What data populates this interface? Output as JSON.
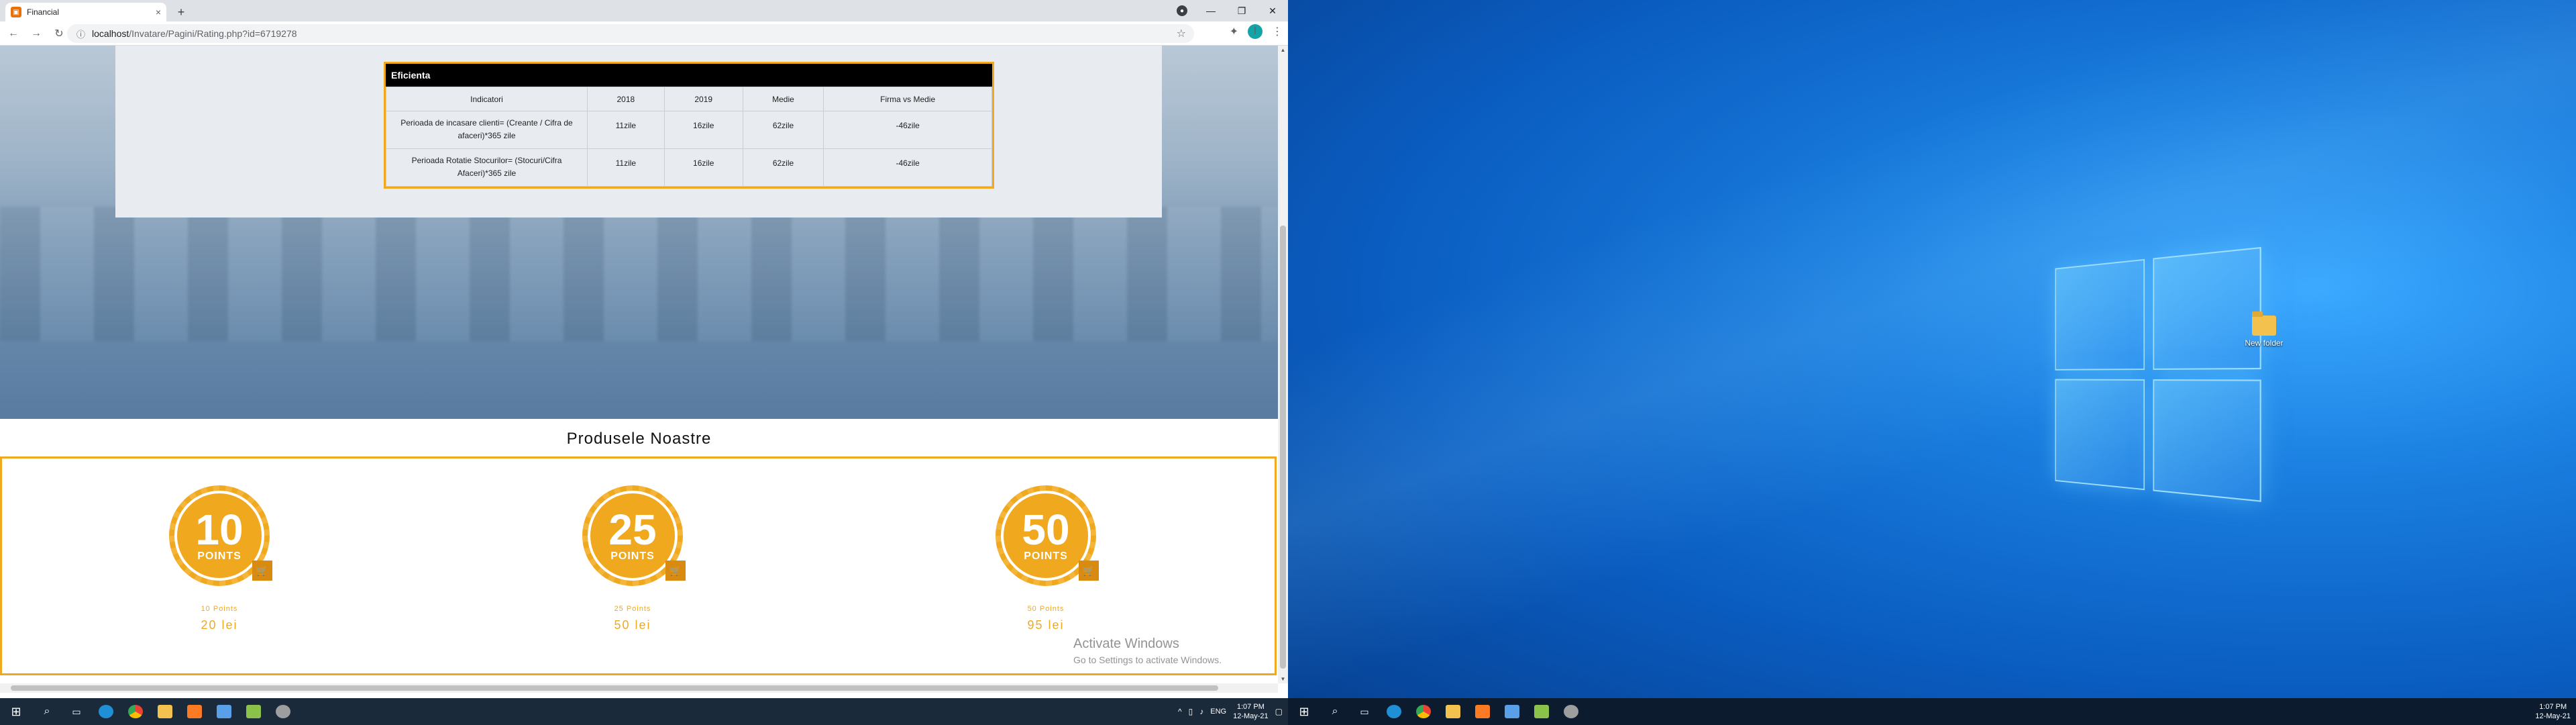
{
  "browser": {
    "tab_title": "Financial",
    "tab_close": "×",
    "newtab": "+",
    "url_host": "localhost",
    "url_path": "/Invatare/Pagini/Rating.php?id=6719278",
    "profile_initial": "I",
    "window_controls": [
      "—",
      "❐",
      "✕"
    ]
  },
  "efficiency_table": {
    "title": "Eficienta",
    "headers": [
      "Indicatori",
      "2018",
      "2019",
      "Medie",
      "Firma vs Medie"
    ],
    "rows": [
      {
        "indicator": "Perioada de incasare clienti= (Creante / Cifra de afaceri)*365 zile",
        "y2018": "11zile",
        "y2019": "16zile",
        "medie": "62zile",
        "vs": "-46zile"
      },
      {
        "indicator": "Perioada Rotatie Stocurilor= (Stocuri/Cifra Afaceri)*365 zile",
        "y2018": "11zile",
        "y2019": "16zile",
        "medie": "62zile",
        "vs": "-46zile"
      }
    ]
  },
  "products": {
    "title": "Produsele Noastre",
    "badge_label": "POINTS",
    "items": [
      {
        "number": "10",
        "points_text": "10 Points",
        "price": "20 lei"
      },
      {
        "number": "25",
        "points_text": "25 Points",
        "price": "50 lei"
      },
      {
        "number": "50",
        "points_text": "50 Points",
        "price": "95 lei"
      }
    ]
  },
  "watermark": {
    "line1": "Activate Windows",
    "line2": "Go to Settings to activate Windows."
  },
  "desktop": {
    "icon_label": "New folder"
  },
  "taskbar_left": {
    "lang": "ENG",
    "time": "1:07 PM",
    "date": "12-May-21"
  },
  "taskbar_right": {
    "time": "1:07 PM",
    "date": "12-May-21"
  },
  "colors": {
    "accent": "#f0a81e",
    "taskbar": "#1b2a3a"
  }
}
